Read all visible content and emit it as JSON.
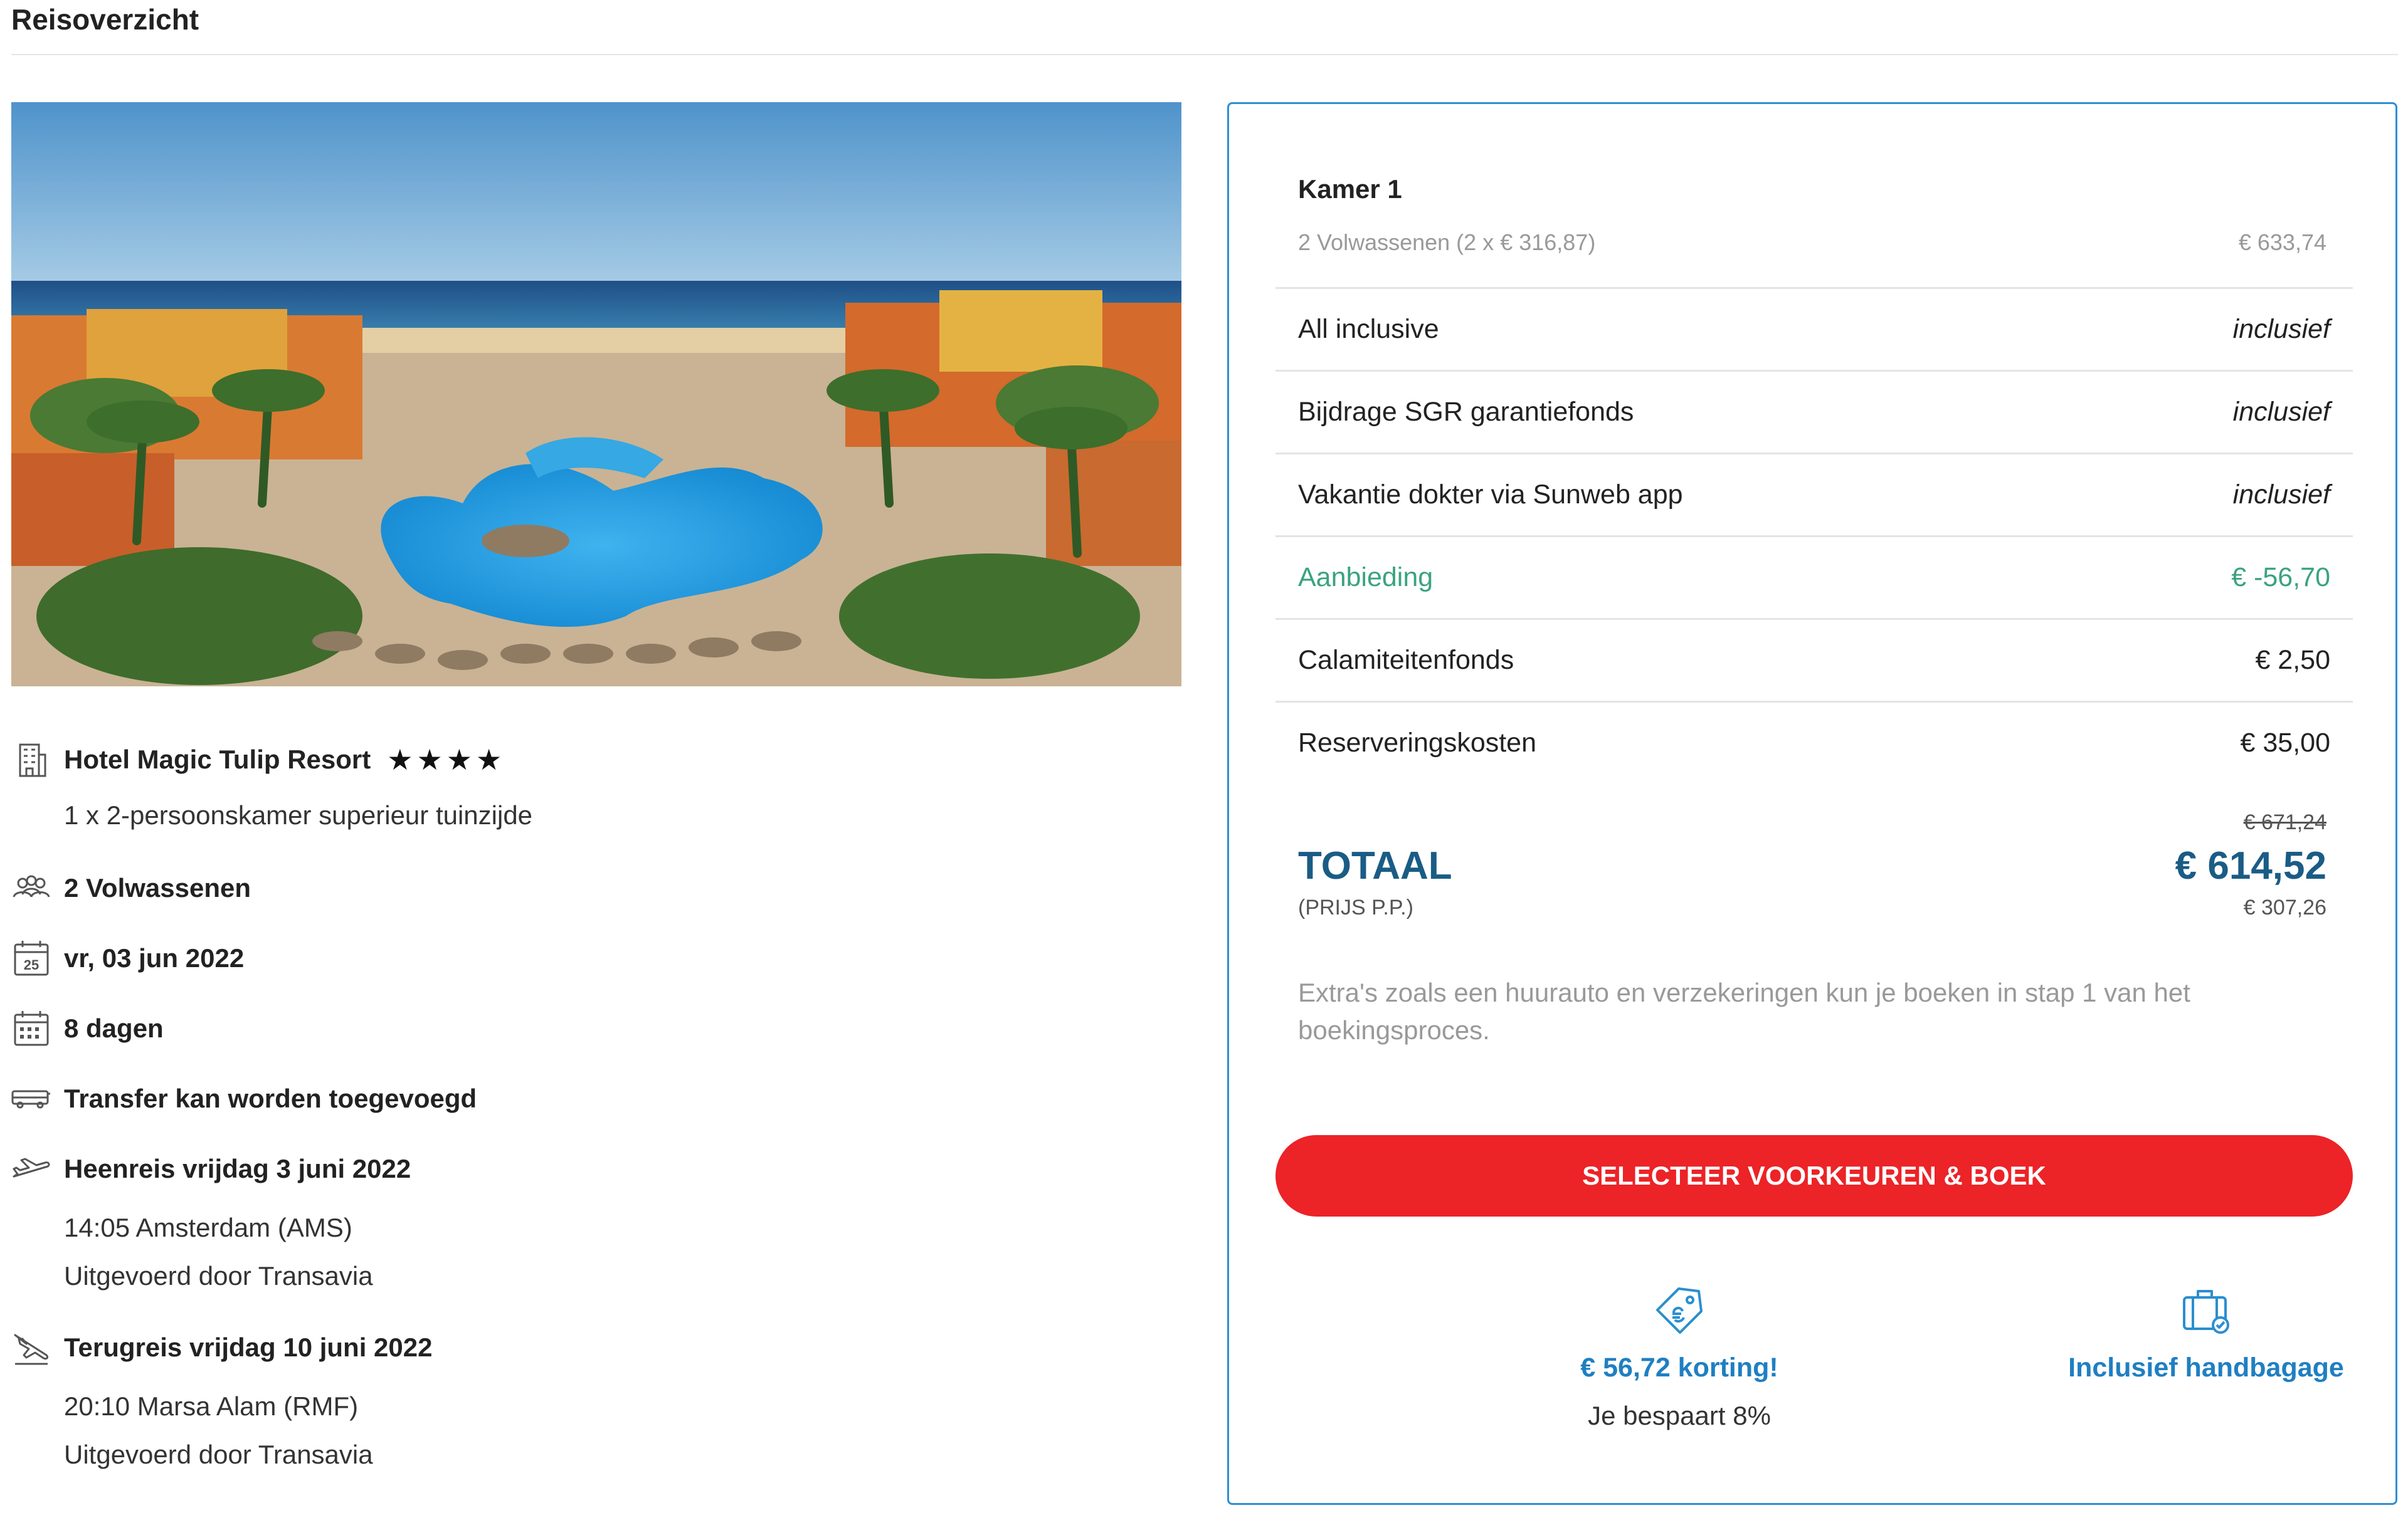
{
  "page": {
    "heading": "Reisoverzicht"
  },
  "hotel": {
    "name": "Hotel Magic Tulip Resort",
    "stars": "★★★★",
    "room": "1 x 2-persoonskamer superieur tuinzijde"
  },
  "trip": {
    "travellers": "2 Volwassenen",
    "date": "vr, 03 jun 2022",
    "calendar_day": "25",
    "duration": "8 dagen",
    "transfer": "Transfer kan worden toegevoegd",
    "outbound": {
      "title": "Heenreis vrijdag 3 juni 2022",
      "time_place": "14:05 Amsterdam (AMS)",
      "operator": "Uitgevoerd door Transavia"
    },
    "return": {
      "title": "Terugreis vrijdag 10 juni 2022",
      "time_place": "20:10 Marsa Alam (RMF)",
      "operator": "Uitgevoerd door Transavia"
    }
  },
  "summary": {
    "room_title": "Kamer 1",
    "room_detail": "2 Volwassenen (2 x € 316,87)",
    "room_price": "€ 633,74",
    "lines": [
      {
        "label": "All inclusive",
        "value": "inclusief"
      },
      {
        "label": "Bijdrage SGR garantiefonds",
        "value": "inclusief"
      },
      {
        "label": "Vakantie dokter via Sunweb app",
        "value": "inclusief"
      },
      {
        "label": "Aanbieding",
        "value": "€ -56,70"
      },
      {
        "label": "Calamiteitenfonds",
        "value": "€ 2,50"
      },
      {
        "label": "Reserveringskosten",
        "value": "€ 35,00"
      }
    ],
    "total_old": "€ 671,24",
    "total_label": "TOTAAL",
    "total_price": "€ 614,52",
    "total_sub": "(PRIJS P.P.)",
    "total_pp": "€ 307,26",
    "extras_note": "Extra's zoals een huurauto en verzekeringen kun je boeken in stap 1 van het boekingsproces.",
    "book_button": "SELECTEER VOORKEUREN & BOEK",
    "perks": {
      "discount_title": "€ 56,72 korting!",
      "discount_sub": "Je bespaart 8%",
      "baggage_title": "Inclusief handbagage"
    }
  },
  "colors": {
    "card_border": "#2f8fd3",
    "offer_green": "#3aa37f",
    "total_blue": "#1a5c85",
    "button_red": "#ec2327",
    "perk_blue": "#1f7fc2"
  },
  "icons": {
    "hotel": "hotel-building-icon",
    "travellers": "people-icon",
    "date": "calendar-day-icon",
    "duration": "calendar-grid-icon",
    "transfer": "bus-icon",
    "outbound": "plane-departure-icon",
    "return": "plane-arrival-icon",
    "discount": "price-tag-icon",
    "baggage": "suitcase-icon"
  }
}
